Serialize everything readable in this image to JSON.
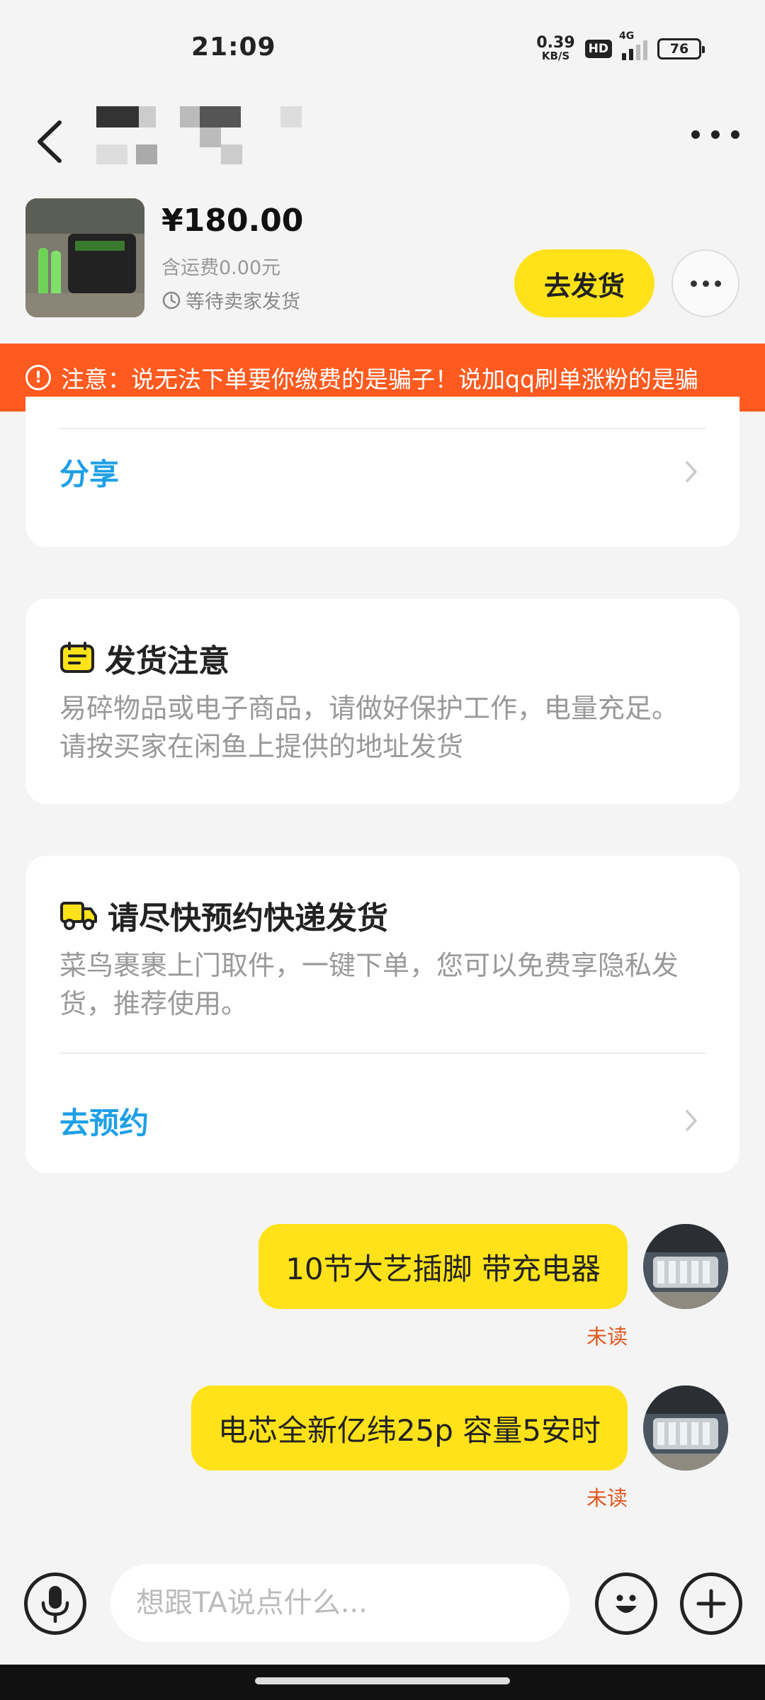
{
  "status_bar": {
    "time": "21:09",
    "net_speed_value": "0.39",
    "net_speed_unit": "KB/S",
    "hd_badge": "HD",
    "network": "4G",
    "battery": "76"
  },
  "header": {
    "title_redacted": true
  },
  "product": {
    "price": "¥180.00",
    "shipping_fee": "含运费0.00元",
    "status": "等待卖家发货",
    "ship_button": "去发货"
  },
  "warning": {
    "text": "注意：说无法下单要你缴费的是骗子！说加qq刷单涨粉的是骗"
  },
  "share_card": {
    "link": "分享"
  },
  "notice_card": {
    "title": "发货注意",
    "body": "易碎物品或电子商品，请做好保护工作，电量充足。请按买家在闲鱼上提供的地址发货"
  },
  "pickup_card": {
    "title": "请尽快预约快递发货",
    "body": "菜鸟裹裹上门取件，一键下单，您可以免费享隐私发货，推荐使用。",
    "link": "去预约"
  },
  "messages": [
    {
      "text": "10节大艺插脚 带充电器",
      "status": "未读"
    },
    {
      "text": "电芯全新亿纬25p   容量5安时",
      "status": "未读"
    }
  ],
  "input": {
    "placeholder": "想跟TA说点什么..."
  },
  "colors": {
    "accent_yellow": "#ffe21a",
    "warning_orange": "#ff5a1f",
    "link_blue": "#1ea0e6",
    "unread_red": "#e05a20"
  },
  "icons": [
    "back-arrow-icon",
    "more-dots-icon",
    "clock-icon",
    "warning-circle-icon",
    "chevron-right-icon",
    "notice-board-icon",
    "delivery-truck-icon",
    "microphone-icon",
    "emoji-icon",
    "plus-circle-icon"
  ]
}
